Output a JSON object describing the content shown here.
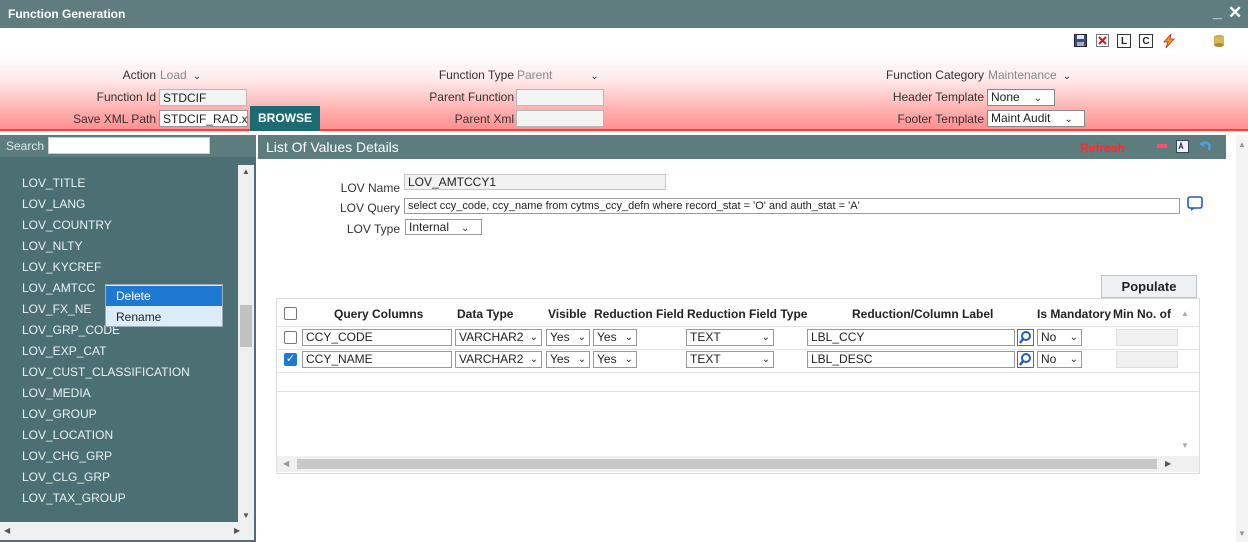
{
  "window": {
    "title": "Function Generation",
    "minimize": "_",
    "close": "✕"
  },
  "toolbar": {
    "icons": [
      "save-icon",
      "delete-icon",
      "L",
      "C",
      "lightning-icon",
      "database-icon"
    ],
    "l_label": "L",
    "c_label": "C"
  },
  "header": {
    "action_label": "Action",
    "action_value": "Load",
    "function_id_label": "Function Id",
    "function_id_value": "STDCIF",
    "save_xml_label": "Save XML Path",
    "save_xml_value": "STDCIF_RAD.xl",
    "browse_label": "BROWSE",
    "function_type_label": "Function Type",
    "function_type_value": "Parent",
    "parent_function_label": "Parent Function",
    "parent_function_value": "",
    "parent_xml_label": "Parent Xml",
    "parent_xml_value": "",
    "function_category_label": "Function Category",
    "function_category_value": "Maintenance",
    "header_template_label": "Header Template",
    "header_template_value": "None",
    "footer_template_label": "Footer Template",
    "footer_template_value": "Maint Audit"
  },
  "sidebar": {
    "search_label": "Search",
    "items": [
      "LOV_TITLE",
      "LOV_LANG",
      "LOV_COUNTRY",
      "LOV_NLTY",
      "LOV_KYCREF",
      "LOV_AMTCC",
      "LOV_FX_NE",
      "LOV_GRP_CODE",
      "LOV_EXP_CAT",
      "LOV_CUST_CLASSIFICATION",
      "LOV_MEDIA",
      "LOV_GROUP",
      "LOV_LOCATION",
      "LOV_CHG_GRP",
      "LOV_CLG_GRP",
      "LOV_TAX_GROUP"
    ]
  },
  "context_menu": {
    "items": [
      "Delete",
      "Rename"
    ],
    "selected": "Delete"
  },
  "main": {
    "title": "List Of Values Details",
    "refresh_label": "Refresh",
    "lov_name_label": "LOV Name",
    "lov_name_value": "LOV_AMTCCY1",
    "lov_query_label": "LOV Query",
    "lov_query_value": "select ccy_code, ccy_name from cytms_ccy_defn where record_stat = 'O' and auth_stat = 'A'",
    "lov_type_label": "LOV Type",
    "lov_type_value": "Internal",
    "populate_label": "Populate",
    "columns": [
      "Query Columns",
      "Data Type",
      "Visible",
      "Reduction Field",
      "Reduction Field Type",
      "Reduction/Column Label",
      "Is Mandatory",
      "Min No. of"
    ],
    "rows": [
      {
        "checked": false,
        "query_column": "CCY_CODE",
        "data_type": "VARCHAR2",
        "visible": "Yes",
        "reduction_field": "Yes",
        "reduction_field_type": "TEXT",
        "label": "LBL_CCY",
        "mandatory": "No"
      },
      {
        "checked": true,
        "query_column": "CCY_NAME",
        "data_type": "VARCHAR2",
        "visible": "Yes",
        "reduction_field": "Yes",
        "reduction_field_type": "TEXT",
        "label": "LBL_DESC",
        "mandatory": "No"
      }
    ]
  },
  "colors": {
    "titlebar": "#5f7d7e",
    "sidebar": "#4b6f72",
    "accent": "#1f78d1",
    "browse": "#1c6a72",
    "refresh": "#ff2a2a"
  }
}
